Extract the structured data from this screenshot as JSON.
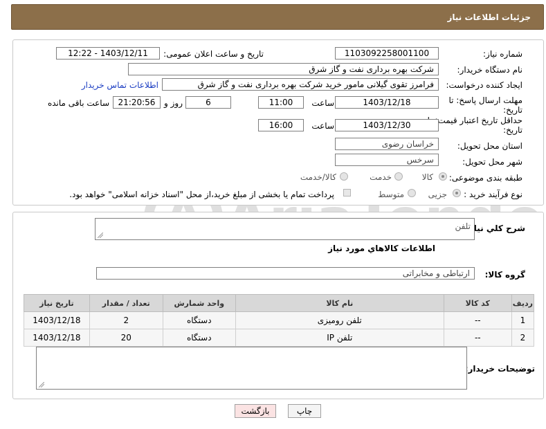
{
  "header": {
    "title": "جزئیات اطلاعات نیاز"
  },
  "need_number": {
    "label": "شماره نیاز:",
    "value": "1103092258001100"
  },
  "announce": {
    "label": "تاریخ و ساعت اعلان عمومی:",
    "value": "1403/12/11 - 12:22"
  },
  "buyer_org": {
    "label": "نام دستگاه خریدار:",
    "value": "شرکت بهره برداری نفت و گاز شرق"
  },
  "creator": {
    "label": "ایجاد کننده درخواست:",
    "value": "فرامرز تقوی گیلانی مامور خرید شرکت بهره برداری نفت و گاز شرق",
    "contact_link": "اطلاعات تماس خریدار"
  },
  "deadline": {
    "label_line1": "مهلت ارسال پاسخ: تا",
    "label_line2": "تاریخ:",
    "date": "1403/12/18",
    "time_label": "ساعت",
    "time": "11:00",
    "days": "6",
    "days_label": "روز و",
    "remaining": "21:20:56",
    "remaining_label": "ساعت باقی مانده"
  },
  "validity": {
    "label_line1": "حداقل تاریخ اعتبار قیمت: تا",
    "label_line2": "تاریخ:",
    "date": "1403/12/30",
    "time_label": "ساعت",
    "time": "16:00"
  },
  "province": {
    "label": "استان محل تحویل:",
    "value": "خراسان رضوی"
  },
  "city": {
    "label": "شهر محل تحویل:",
    "value": "سرخس"
  },
  "category": {
    "label": "طبقه بندی موضوعی:",
    "options": [
      "کالا",
      "خدمت",
      "کالا/خدمت"
    ],
    "selected": "کالا"
  },
  "process": {
    "label": "نوع فرآیند خرید :",
    "options": [
      "جزیی",
      "متوسط"
    ],
    "selected": "جزیی",
    "payment_note": "پرداخت تمام یا بخشی از مبلغ خرید،از محل \"اسناد خزانه اسلامی\" خواهد بود."
  },
  "summary": {
    "label": "شرح کلي نياز:",
    "value": "تلفن"
  },
  "goods_info_title": "اطلاعات کالاهاي مورد نياز",
  "goods_group": {
    "label": "گروه کالا:",
    "value": "ارتباطی و مخابراتی"
  },
  "table": {
    "headers": [
      "ردیف",
      "کد کالا",
      "نام کالا",
      "واحد شمارش",
      "تعداد / مقدار",
      "تاریخ نیاز"
    ],
    "rows": [
      [
        "1",
        "--",
        "تلفن رومیزی",
        "دستگاه",
        "2",
        "1403/12/18"
      ],
      [
        "2",
        "--",
        "تلفن IP",
        "دستگاه",
        "20",
        "1403/12/18"
      ]
    ]
  },
  "buyer_notes": {
    "label": "توضیحات خریدار:",
    "value": ""
  },
  "buttons": {
    "print": "چاپ",
    "back": "بازگشت"
  },
  "watermark": {
    "text": "AriaTender.neT"
  },
  "colors": {
    "header_bg": "#8c6f4a",
    "link": "#1a3cc2",
    "back_btn_bg": "#fbe3e3",
    "print_btn_bg": "#f4f4f4"
  }
}
